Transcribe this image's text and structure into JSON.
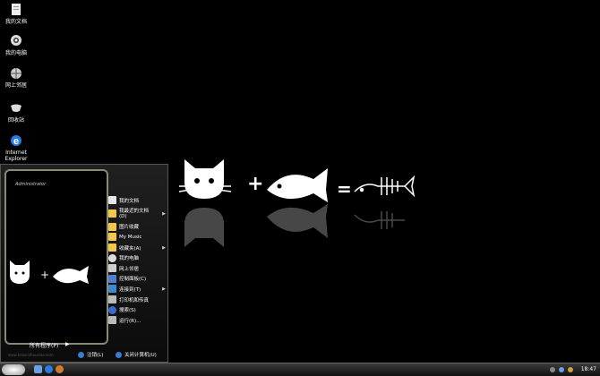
{
  "desktop": {
    "icons": [
      {
        "label": "我的文档",
        "icon": "my-documents-icon"
      },
      {
        "label": "我的电脑",
        "icon": "my-computer-icon"
      },
      {
        "label": "网上邻居",
        "icon": "network-places-icon"
      },
      {
        "label": "回收站",
        "icon": "recycle-bin-icon"
      },
      {
        "label": "Internet\nExplorer",
        "icon": "internet-explorer-icon"
      }
    ]
  },
  "start_menu": {
    "user": "Administrator",
    "all_programs": "所有程序(P)",
    "items": [
      {
        "label": "我的文档",
        "icon": "documents-icon",
        "color": "#e8e8e8",
        "arrow": false
      },
      {
        "label": "我最近的文档\n(D)",
        "icon": "recent-docs-icon",
        "color": "#f2c74a",
        "arrow": true
      },
      {
        "label": "图片收藏",
        "icon": "pictures-icon",
        "color": "#f2c74a",
        "arrow": false
      },
      {
        "label": "My Music",
        "icon": "music-icon",
        "color": "#f2c74a",
        "arrow": false
      },
      {
        "label": "收藏夹(A)",
        "icon": "favorites-icon",
        "color": "#f2c74a",
        "arrow": true
      },
      {
        "label": "我的电脑",
        "icon": "computer-icon",
        "color": "#dddddd",
        "arrow": false
      },
      {
        "label": "网上邻居",
        "icon": "network-icon",
        "color": "#cfcfcf",
        "arrow": false
      },
      {
        "label": "控制面板(C)",
        "icon": "control-panel-icon",
        "color": "#4a7fd4",
        "arrow": false
      },
      {
        "label": "连接到(T)",
        "icon": "connect-icon",
        "color": "#3a8ad0",
        "arrow": true
      },
      {
        "label": "打印机和传真",
        "icon": "printer-icon",
        "color": "#bbbbbb",
        "arrow": false
      },
      {
        "label": "搜索(S)",
        "icon": "search-icon",
        "color": "#3a6ad0",
        "arrow": false
      },
      {
        "label": "运行(R)...",
        "icon": "run-icon",
        "color": "#bbbbbb",
        "arrow": false
      }
    ],
    "logoff": "注销(L)",
    "shutdown": "关闭计算机(U)",
    "url": "www.hexonzhouxiao.com"
  },
  "taskbar": {
    "clock": "18:47"
  },
  "colors": {
    "background": "#000000",
    "accent": "#8a8a74"
  }
}
